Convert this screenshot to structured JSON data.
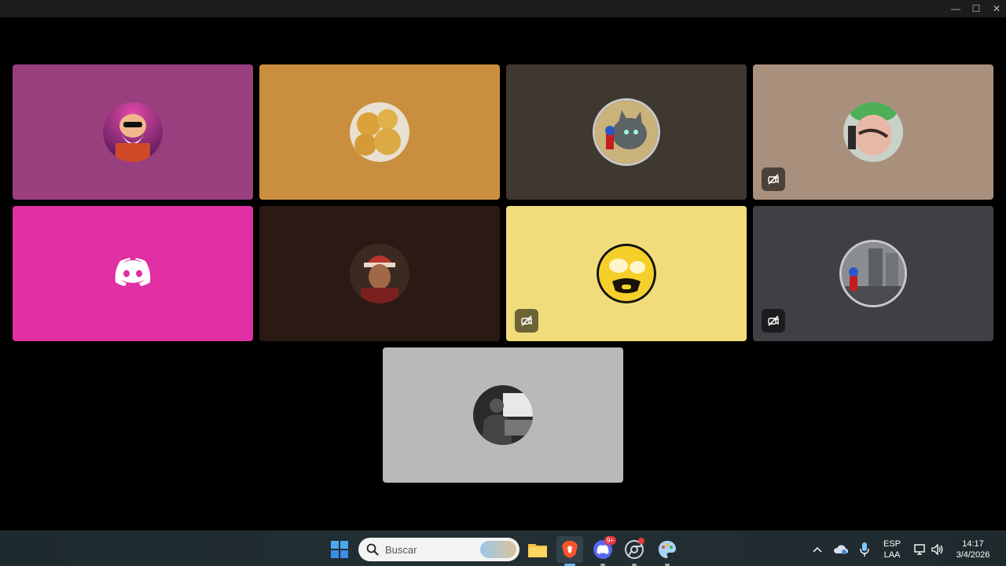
{
  "window": {
    "minimize_glyph": "—",
    "maximize_glyph": "☐",
    "close_glyph": "✕"
  },
  "participants": [
    {
      "id": "p1",
      "tile_color": "#9a3f7e",
      "avatar": "old-man-sunglasses-avatar",
      "muted": false
    },
    {
      "id": "p2",
      "tile_color": "#c98f3e",
      "avatar": "bread-rolls-avatar",
      "muted": false
    },
    {
      "id": "p3",
      "tile_color": "#3e3830",
      "avatar": "cat-with-mario-figure-avatar",
      "muted": false
    },
    {
      "id": "p4",
      "tile_color": "#a9907d",
      "avatar": "person-green-cap-avatar",
      "muted": true
    },
    {
      "id": "p5",
      "tile_color": "#df2fa3",
      "avatar": "discord-default-avatar",
      "muted": false
    },
    {
      "id": "p6",
      "tile_color": "#2b1a13",
      "avatar": "person-red-beanie-avatar",
      "muted": false
    },
    {
      "id": "p7",
      "tile_color": "#f0dc7a",
      "avatar": "yellow-face-glasses-avatar",
      "muted": true
    },
    {
      "id": "p8",
      "tile_color": "#3f3f44",
      "avatar": "street-with-mario-figure-avatar",
      "muted": true
    },
    {
      "id": "p9",
      "tile_color": "#b9b9b9",
      "avatar": "bw-person-photo-avatar",
      "muted": false
    }
  ],
  "taskbar": {
    "search_placeholder": "Buscar",
    "discord_badge": "9+",
    "apps": [
      "start-icon",
      "file-explorer-icon",
      "brave-browser-icon",
      "discord-icon",
      "chrome-icon",
      "paint-icon"
    ],
    "tray": {
      "language_line1": "ESP",
      "language_line2": "LAA",
      "time": "14:17",
      "date": "3/4/2026"
    }
  },
  "colors": {
    "accent_blue": "#3a8ee6",
    "discord_blurple": "#5865f2",
    "mute_bg": "rgba(0,0,0,0.55)"
  }
}
